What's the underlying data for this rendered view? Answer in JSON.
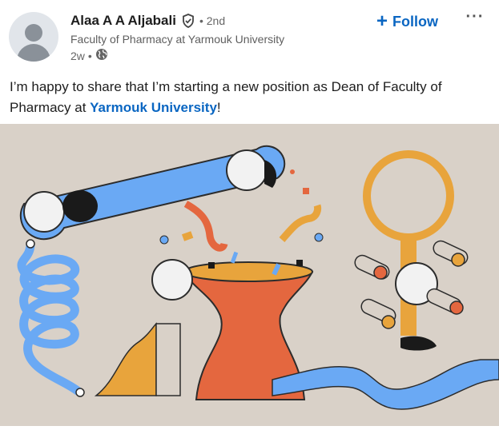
{
  "author": {
    "name": "Alaa A A Aljabali",
    "degree": "• 2nd",
    "headline": "Faculty of Pharmacy at Yarmouk University",
    "time": "2w",
    "visibility_icon": "globe-icon"
  },
  "actions": {
    "follow_label": "Follow",
    "more_label": "···"
  },
  "post": {
    "text_before": "I’m happy to share that I’m starting a new position as Dean of Faculty of Pharmacy at ",
    "link_text": "Yarmouk University",
    "text_after": "!"
  },
  "colors": {
    "accent": "#0a66c2",
    "image_bg": "#d9d1c8",
    "blue": "#6aa9f4",
    "orange": "#e8a43c",
    "red": "#e4673f"
  }
}
